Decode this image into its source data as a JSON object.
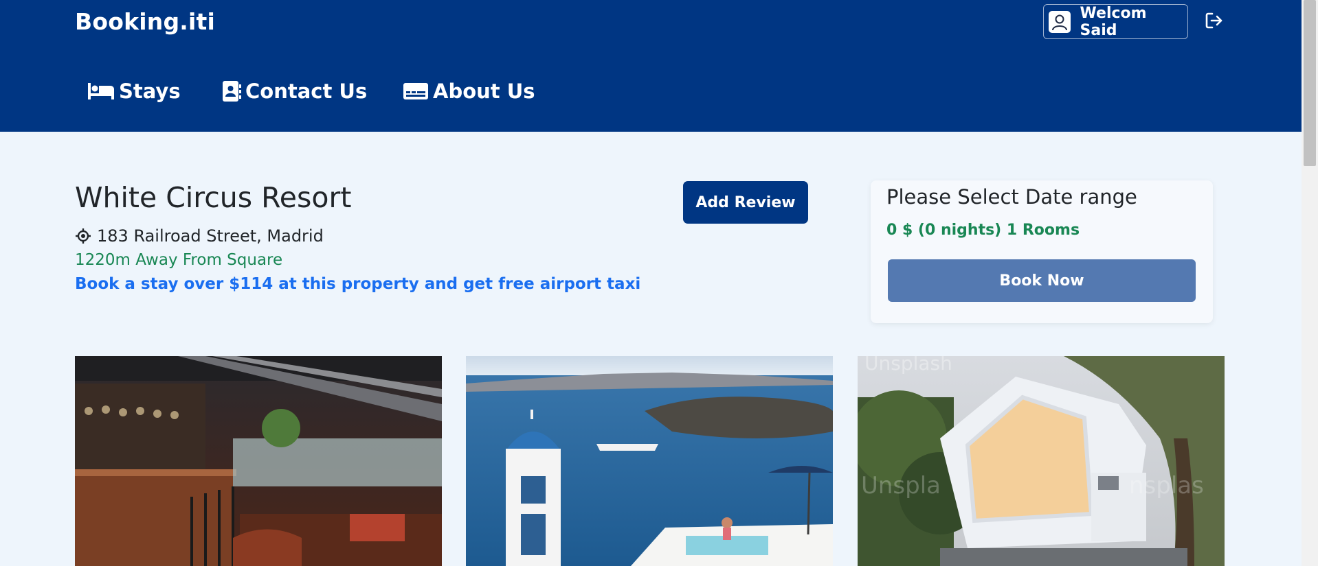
{
  "header": {
    "brand": "Booking.iti",
    "user_greeting": "Welcom Said",
    "user_icon": "user-avatar-icon",
    "logout_icon": "logout-icon",
    "background_color": "#003683"
  },
  "nav": {
    "items": [
      {
        "label": "Stays",
        "icon": "bed-icon"
      },
      {
        "label": "Contact Us",
        "icon": "contact-book-icon"
      },
      {
        "label": "About Us",
        "icon": "id-card-icon"
      }
    ]
  },
  "hotel": {
    "name": "White Circus Resort",
    "address": "183 Railroad Street, Madrid",
    "address_icon": "location-crosshair-icon",
    "distance": "1220m Away From Square",
    "promo": "Book a stay over $114 at this property and get free airport taxi",
    "add_review_label": "Add Review"
  },
  "booking": {
    "title": "Please Select Date range",
    "summary": "0 $ (0 nights) 1 Rooms",
    "book_now_label": "Book Now"
  },
  "gallery": {
    "images": [
      {
        "alt": "Resort bar interior"
      },
      {
        "alt": "Santorini sea view with pool"
      },
      {
        "alt": "Modern white villa"
      }
    ]
  }
}
